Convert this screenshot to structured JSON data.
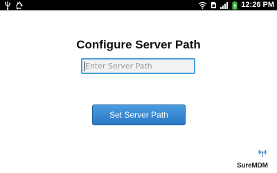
{
  "status_bar": {
    "time": "12:26 PM",
    "icons": [
      "usb-icon",
      "recycle-icon",
      "wifi-icon",
      "sim-icon",
      "signal-icon",
      "battery-charging-icon"
    ]
  },
  "main": {
    "title": "Configure Server Path",
    "server_input": {
      "placeholder": "Enter Server Path",
      "value": ""
    },
    "set_button_label": "Set Server Path"
  },
  "branding": {
    "logo_text": "SureMDM"
  },
  "colors": {
    "status_bar_bg": "#000000",
    "input_border": "#4a9fd8",
    "button_bg": "#2f7fcc",
    "battery": "#3ec23e"
  }
}
